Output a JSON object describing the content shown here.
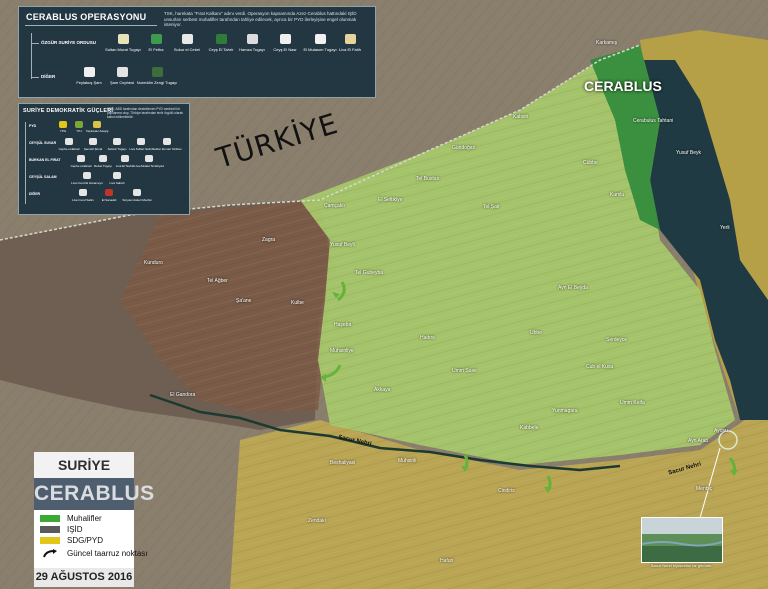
{
  "map": {
    "country_label": "TÜRKİYE",
    "city_label": "CERABLUS"
  },
  "operation_panel": {
    "title": "CERABLUS OPERASYONU",
    "description": "TSK, harekata \"Fırat Kalkanı\" adını verdi. Operasyon kapsamında Azez-Cerablus hattındaki IŞİD unsurları serbest muhalifler tarafından tahliye edilecek, ayrıca bir PYD ilerleyişine engel olunmak isteniyor.",
    "categories": [
      {
        "label": "ÖZGÜR SURİYE ORDUSU",
        "groups": [
          "Sultan Murat Tugayı",
          "El Fetha",
          "Sukur el Cebel",
          "Ceyş El Tahrir",
          "Hamza Tugayı",
          "Ceyş El Nasr",
          "El Mutasım Tugayı",
          "Liva El Fatih"
        ]
      },
      {
        "label": "DİĞER",
        "groups": [
          "Feylakuş Şam",
          "Şam Cephesi",
          "Nureddin Zengi Tugayı"
        ]
      }
    ]
  },
  "sdg_panel": {
    "title": "SURİYE DEMOKRATİK GÜÇLERİ",
    "description": "SDG, ABD tarafından desteklenen PYD merkezli bir yapılanma olup, Türkiye tarafından terör örgütü olarak kabul edilmektedir.",
    "categories": [
      {
        "label": "PYD",
        "groups": [
          "YPG",
          "YPJ",
          "Yapılanan Asayiş"
        ]
      },
      {
        "label": "CEYŞÜL SUVAR",
        "groups": [
          "Cephe el-Ekrad",
          "Şemsül Şimal",
          "Selcuk Tugayı",
          "Liva Sultan Selim",
          "Suklar Zuman Tarihan"
        ]
      },
      {
        "label": "BURKAN EL FIRAT",
        "groups": [
          "Cephe el-Ekrad",
          "Rebet Tugayı",
          "Liva El Tavhid",
          "Liva Atbalet Tel Ebyad"
        ]
      },
      {
        "label": "CEYŞÜL SALAM",
        "groups": [
          "Liva Cund El Harameyn",
          "Liva Sabah"
        ]
      },
      {
        "label": "DİĞER",
        "groups": [
          "Liva Cund Salim",
          "El Sanadid",
          "Süryani Askeri Meclisi"
        ]
      }
    ]
  },
  "legend": {
    "brand_top": "SURİYE GÜNDEMİ",
    "brand_main": "CERABLUS",
    "items": [
      {
        "label": "Muhalifler",
        "color": "#3aaa35"
      },
      {
        "label": "IŞİD",
        "color": "#5a5a5a"
      },
      {
        "label": "SDG/PYD",
        "color": "#e3c61a"
      },
      {
        "label": "Güncel taarruz noktası",
        "color": "#111111"
      }
    ],
    "date": "29 AĞUSTOS 2016"
  },
  "rivers": [
    {
      "label": "Sacur Nehri"
    },
    {
      "label": "Sacur Nehri"
    }
  ],
  "places": [
    "Karkamış",
    "Kabsin",
    "Gündoğan",
    "Zagra",
    "Kunduro",
    "Tel Ağber",
    "Şa'ane",
    "Kulbe",
    "Tel Şair",
    "El Seltikiye",
    "Tel Bustan",
    "Çamçaklı",
    "Yusuf Beyli",
    "Tel Gubeyba",
    "Haşeba",
    "Muhsinliye",
    "Akkaya",
    "El Gandora",
    "Beshaliyasi",
    "Muhsinli",
    "Hadıre",
    "Ayn El Beyda",
    "Ubbe",
    "Umm Suse",
    "Yunmagara",
    "Kabbele",
    "Cub el Kusu",
    "Umm Keifa",
    "Serdeyce",
    "Cerabulus Tahtani",
    "Yusuf Beyk",
    "Cübbe",
    "Kumlu",
    "Yerli",
    "Ayn Arab",
    "Menbiç",
    "Zendaki",
    "Cindiris",
    "Hafun",
    "Ayosu"
  ],
  "photo_caption": "Sacur Nehri kıyısından bir görüntü"
}
